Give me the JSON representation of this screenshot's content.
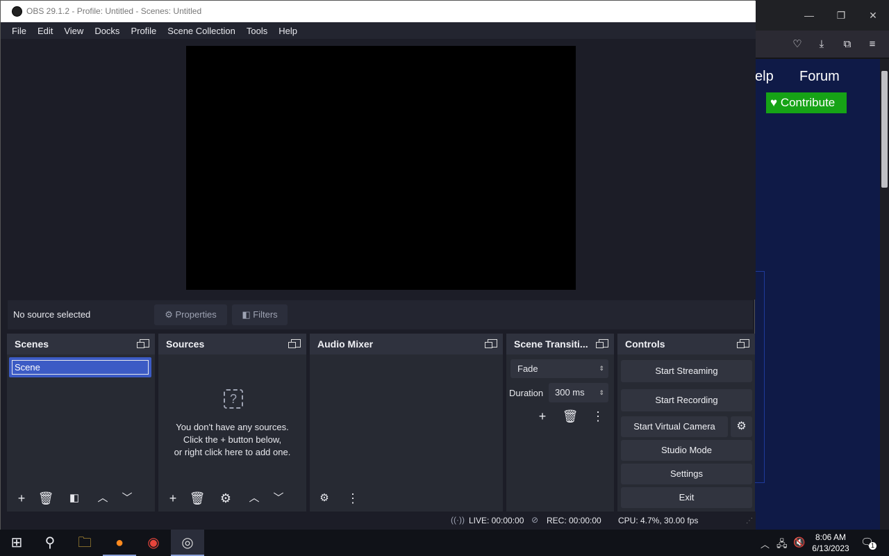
{
  "obs": {
    "title": "OBS 29.1.2 - Profile: Untitled - Scenes: Untitled",
    "menu": [
      "File",
      "Edit",
      "View",
      "Docks",
      "Profile",
      "Scene Collection",
      "Tools",
      "Help"
    ],
    "source_bar": {
      "status": "No source selected",
      "properties": "Properties",
      "filters": "Filters"
    },
    "docks": {
      "scenes": {
        "title": "Scenes",
        "items": [
          "Scene"
        ]
      },
      "sources": {
        "title": "Sources",
        "empty_line1": "You don't have any sources.",
        "empty_line2": "Click the + button below,",
        "empty_line3": "or right click here to add one."
      },
      "audio_mixer": {
        "title": "Audio Mixer"
      },
      "transitions": {
        "title": "Scene Transiti...",
        "selected": "Fade",
        "duration_label": "Duration",
        "duration_value": "300 ms"
      },
      "controls": {
        "title": "Controls",
        "start_streaming": "Start Streaming",
        "start_recording": "Start Recording",
        "start_virtual_camera": "Start Virtual Camera",
        "studio_mode": "Studio Mode",
        "settings": "Settings",
        "exit": "Exit"
      }
    },
    "status": {
      "live": "LIVE: 00:00:00",
      "rec": "REC: 00:00:00",
      "cpu": "CPU: 4.7%, 30.00 fps"
    }
  },
  "browser": {
    "nav_help": "elp",
    "nav_forum": "Forum",
    "contribute": "Contribute"
  },
  "taskbar": {
    "time": "8:06 AM",
    "date": "6/13/2023",
    "notifications": "1"
  },
  "colors": {
    "contribute_green": "#16a316",
    "obs_bg": "#1c1d27",
    "selected_scene": "#3c5bc5"
  }
}
